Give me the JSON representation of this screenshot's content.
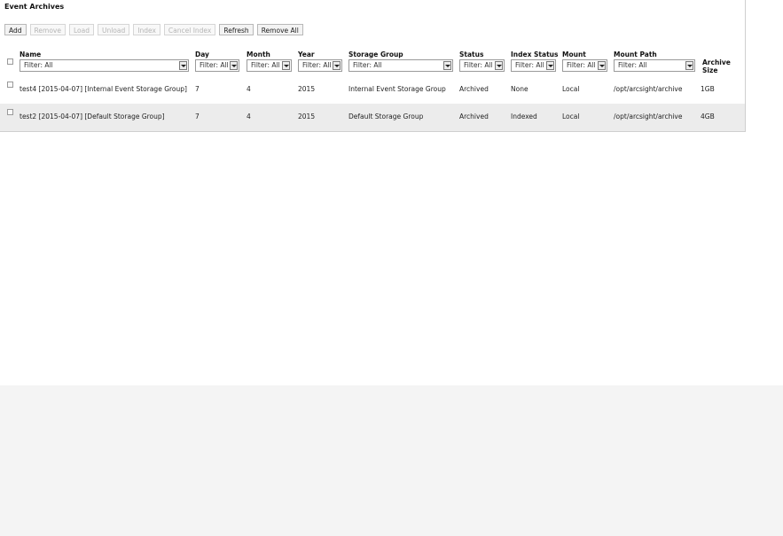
{
  "panel": {
    "title": "Event Archives"
  },
  "toolbar": {
    "buttons": [
      {
        "label": "Add",
        "enabled": true
      },
      {
        "label": "Remove",
        "enabled": false
      },
      {
        "label": "Load",
        "enabled": false
      },
      {
        "label": "Unload",
        "enabled": false
      },
      {
        "label": "Index",
        "enabled": false
      },
      {
        "label": "Cancel Index",
        "enabled": false
      },
      {
        "label": "Refresh",
        "enabled": true
      },
      {
        "label": "Remove All",
        "enabled": true
      }
    ]
  },
  "table": {
    "columns": [
      {
        "key": "name",
        "label": "Name",
        "filter": "Filter: All"
      },
      {
        "key": "day",
        "label": "Day",
        "filter": "Filter: All"
      },
      {
        "key": "month",
        "label": "Month",
        "filter": "Filter: All"
      },
      {
        "key": "year",
        "label": "Year",
        "filter": "Filter: All"
      },
      {
        "key": "storage_group",
        "label": "Storage Group",
        "filter": "Filter: All"
      },
      {
        "key": "status",
        "label": "Status",
        "filter": "Filter: All"
      },
      {
        "key": "index_status",
        "label": "Index Status",
        "filter": "Filter: All"
      },
      {
        "key": "mount",
        "label": "Mount",
        "filter": "Filter: All"
      },
      {
        "key": "mount_path",
        "label": "Mount Path",
        "filter": "Filter: All"
      },
      {
        "key": "archive_size",
        "label": "Archive Size",
        "filter": null
      }
    ],
    "rows": [
      {
        "name": "test4 [2015-04-07] [Internal Event Storage Group]",
        "day": "7",
        "month": "4",
        "year": "2015",
        "storage_group": "Internal Event Storage Group",
        "status": "Archived",
        "index_status": "None",
        "mount": "Local",
        "mount_path": "/opt/arcsight/archive",
        "archive_size": "1GB"
      },
      {
        "name": "test2 [2015-04-07] [Default Storage Group]",
        "day": "7",
        "month": "4",
        "year": "2015",
        "storage_group": "Default Storage Group",
        "status": "Archived",
        "index_status": "Indexed",
        "mount": "Local",
        "mount_path": "/opt/arcsight/archive",
        "archive_size": "4GB"
      }
    ]
  }
}
